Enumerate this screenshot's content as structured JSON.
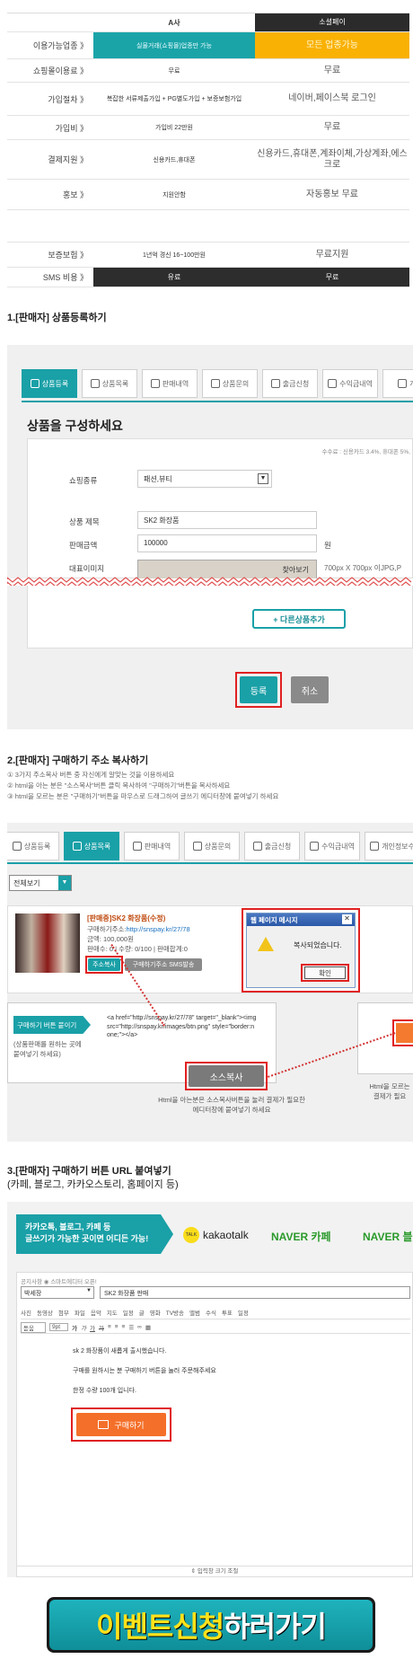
{
  "compare": {
    "header": {
      "a": "A사",
      "b": "소셜페이"
    },
    "rows": [
      {
        "label": "이용가능업종 》",
        "a": "실물거래(쇼핑몰)업종만 가능",
        "b": "모든 업종가능"
      },
      {
        "label": "쇼핑몰이용료 》",
        "a": "무료",
        "b": "무료"
      },
      {
        "label": "가입절차 》",
        "a": "복잡한 서류제출가입 + PG별도가입 + 보증보험가입",
        "b": "네이버,페이스북 로그인"
      },
      {
        "label": "가입비 》",
        "a": "가입비 22만원",
        "b": "무료"
      },
      {
        "label": "결제지원 》",
        "a": "신용카드,휴대폰",
        "b": "신용카드,휴대폰,계좌이체,가상계좌,에스크로"
      },
      {
        "label": "홍보 》",
        "a": "지원안함",
        "b": "자동홍보 무료"
      },
      {
        "label": "",
        "a": "",
        "b": ""
      },
      {
        "label": "보증보험 》",
        "a": "1년억 경신 16~100만원",
        "b": "무료지원"
      },
      {
        "label": "SMS 비용 》",
        "a": "유료",
        "b": "무료"
      }
    ]
  },
  "section1": {
    "title": "1.[판매자] 상품등록하기",
    "tabs": [
      "상품등록",
      "상품목록",
      "판매내역",
      "상품문의",
      "출금신청",
      "수익금내역",
      "개인"
    ],
    "heading": "상품을 구성하세요",
    "fee_note": "수수료 : 신용카드 3.4%, 휴대폰 5%,",
    "fields": {
      "category_label": "쇼핑종류",
      "category_value": "패션,뷰티",
      "title_label": "상품 제목",
      "title_value": "SK2 화장품",
      "price_label": "판매금액",
      "price_value": "100000",
      "price_unit": "원",
      "image_label": "대표이미지",
      "image_btn": "찾아보기",
      "image_hint": "700px X 700px 이JPG,P"
    },
    "add_button": "+ 다른상품추가",
    "submit_button": "등록",
    "cancel_button": "취소"
  },
  "section2": {
    "title": "2.[판매자] 구매하기 주소 복사하기",
    "notes": [
      "① 3가지 주소복사 버튼 중 자신에게 알맞는 것을 이용하세요",
      "② html을 아는 분은 \"소스복사\"버튼 클릭 복사하여 \"구매하기\"버튼을 복사하세요",
      "③ html을 모르는 분은 \"구매하기\"버튼을 마우스로 드래그하여 글쓰기 에디터창에 붙여넣기 하세요"
    ],
    "tabs": [
      "상품등록",
      "상품목록",
      "판매내역",
      "상품문의",
      "출금신청",
      "수익금내역",
      "개인정보수"
    ],
    "filter": "전체보기",
    "product": {
      "name": "[판매중]SK2 화장품(수정)",
      "url_label": "구매하기주소:",
      "url": "http://snspay.kr/27/78",
      "price": "금액: 100,000원",
      "stock": "판매수: 0 | 수량: 0/100 | 판매합계:0"
    },
    "copy_button": "주소복사",
    "sms_button": "구매하기주소 SMS발송",
    "dialog": {
      "title": "웹 페이지 메시지",
      "message": "복사되었습니다.",
      "ok": "확인"
    },
    "buy_btn_tag": "구매하기 버튼 붙이기",
    "buy_btn_desc": "(상품판매를 원하는 곳에\n붙여넣기 하세요)",
    "source_code": "<a href=\"http://snspay.kr/27/78\" target=\"_blank\"><img src=\"http://snspay.kr/images/btn.png\" style=\"border:none;\"></a>",
    "source_button": "소스복사",
    "source_desc": "Html을 아는분은 소스복사버튼을 눌러 결제가 필요한\n에디터창에 붙여넣기 하세요",
    "right_desc": "Html을 모르는\n결제가 필요"
  },
  "section3": {
    "title": "3.[판매자] 구매하기 버튼 URL 붙여넣기",
    "subtitle": "(카페, 블로그, 카카오스토리, 홈페이지 등)",
    "banner_text": "카카오톡, 블로그, 카페 등\n글쓰기가 가능한 곳이면 어디든 가능!",
    "brands": [
      "kakaotalk",
      "NAVER 카페",
      "NAVER 블"
    ],
    "notice": "공지사항  ◉ 스마트에디터 오픈!",
    "board_select": "박세장",
    "post_title": "SK2 화장품 판매",
    "toolbar1": [
      "사진",
      "동영상",
      "첨부",
      "파일",
      "음악",
      "지도",
      "일정",
      "글",
      "영화",
      "TV방송",
      "앨범",
      "수식",
      "투표",
      "일정"
    ],
    "font_select": "돋움",
    "size_select": "9pt",
    "body_lines": [
      "sk 2 화장품이 새롭게 출시했습니다.",
      "구매를 원하시는 분 구매하기 버튼을 눌러 주문해주세요",
      "한정 수량 100개 입니다."
    ],
    "buy_button": "구매하기",
    "resize_hint": "⇕ 입력창 크기 조절"
  },
  "event": {
    "part1": "이벤트신청",
    "part2": "하러가기"
  }
}
